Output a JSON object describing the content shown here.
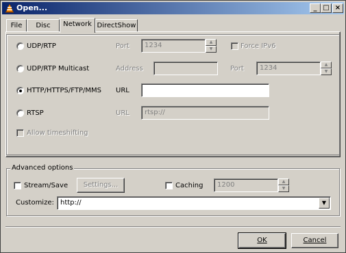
{
  "window": {
    "title": "Open...",
    "min_label": "_",
    "max_label": "□",
    "close_label": "×"
  },
  "tabs": [
    "File",
    "Disc",
    "Network",
    "DirectShow"
  ],
  "active_tab": "Network",
  "network": {
    "udp": {
      "label": "UDP/RTP",
      "port_label": "Port",
      "port_value": "1234",
      "force_ipv6_label": "Force IPv6"
    },
    "multicast": {
      "label": "UDP/RTP Multicast",
      "address_label": "Address",
      "address_value": "",
      "port_label": "Port",
      "port_value": "1234"
    },
    "http": {
      "label": "HTTP/HTTPS/FTP/MMS",
      "url_label": "URL",
      "url_value": ""
    },
    "rtsp": {
      "label": "RTSP",
      "url_label": "URL",
      "url_value": "rtsp://"
    },
    "timeshift_label": "Allow timeshifting"
  },
  "advanced": {
    "legend": "Advanced options",
    "stream_save_label": "Stream/Save",
    "settings_button": "Settings...",
    "caching_label": "Caching",
    "caching_value": "1200",
    "customize_label": "Customize:",
    "customize_value": "http://"
  },
  "buttons": {
    "ok": "OK",
    "cancel": "Cancel"
  }
}
